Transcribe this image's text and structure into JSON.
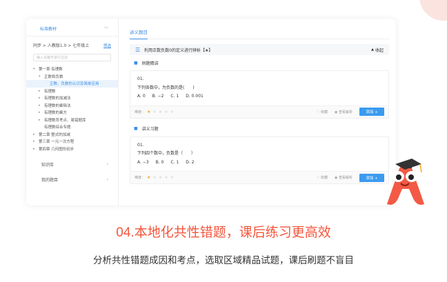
{
  "sidebar": {
    "textbook_label": "标准教材",
    "path": "同步 > 人教版1.0 > 七年级上",
    "filter_label": "筛选",
    "search_placeholder": "输入关键字进行过滤",
    "tree": [
      {
        "label": "第一章 有理数",
        "level": 0,
        "arrow": "▾"
      },
      {
        "label": "正数和负数",
        "level": 1,
        "arrow": "▾"
      },
      {
        "label": "正数、负数的认识及简单应用",
        "level": 2,
        "arrow": "",
        "active": true
      },
      {
        "label": "有理数",
        "level": 1,
        "arrow": "▸"
      },
      {
        "label": "有理数的加减法",
        "level": 1,
        "arrow": "▸"
      },
      {
        "label": "有理数的乘除法",
        "level": 1,
        "arrow": "▸"
      },
      {
        "label": "有理数的乘方",
        "level": 1,
        "arrow": "▸"
      },
      {
        "label": "有理数背考点、易错题库",
        "level": 1,
        "arrow": "▸"
      },
      {
        "label": "有理数综合专题",
        "level": 1,
        "arrow": ""
      },
      {
        "label": "第二章 整式的加减",
        "level": 0,
        "arrow": "▸"
      },
      {
        "label": "第三章 一元一次方程",
        "level": 0,
        "arrow": "▸"
      },
      {
        "label": "第四章 几何图形初步",
        "level": 0,
        "arrow": "▸"
      }
    ],
    "links": [
      {
        "label": "知识库"
      },
      {
        "label": "我的题目"
      }
    ]
  },
  "main": {
    "tab_label": "讲义题目",
    "lesson_title": "利用正数负数0的定义进行辨析【★】",
    "collapse_label": "收起",
    "sections": [
      {
        "title": "例题精讲",
        "question": {
          "number": "01.",
          "stem": "下列各数中，为负数的是(　　)",
          "options": [
            "A. 0",
            "B. −2",
            "C. 1",
            "D. 0.001"
          ],
          "difficulty_label": "难度：",
          "stars_on": 1,
          "stars_total": 5,
          "favorite_label": "收藏",
          "analysis_label": "查看解析",
          "add_label": "添加 +"
        }
      },
      {
        "title": "讲义习题",
        "question": {
          "number": "01.",
          "stem": "下列四个数中，负数是（　　）",
          "options": [
            "A. −3",
            "B. 0",
            "C. 1",
            "D. 2"
          ],
          "difficulty_label": "难度：",
          "stars_on": 1,
          "stars_total": 5,
          "favorite_label": "收藏",
          "analysis_label": "查看解析",
          "add_label": "添加 +"
        }
      }
    ]
  },
  "headline": "04.本地化共性错题，课后练习更高效",
  "subline": "分析共性错题成因和考点，选取区域精品试题，课后刷题不盲目",
  "colors": {
    "accent": "#3a8ee6",
    "headline": "#f3553c",
    "mascot": "#f25a45"
  }
}
